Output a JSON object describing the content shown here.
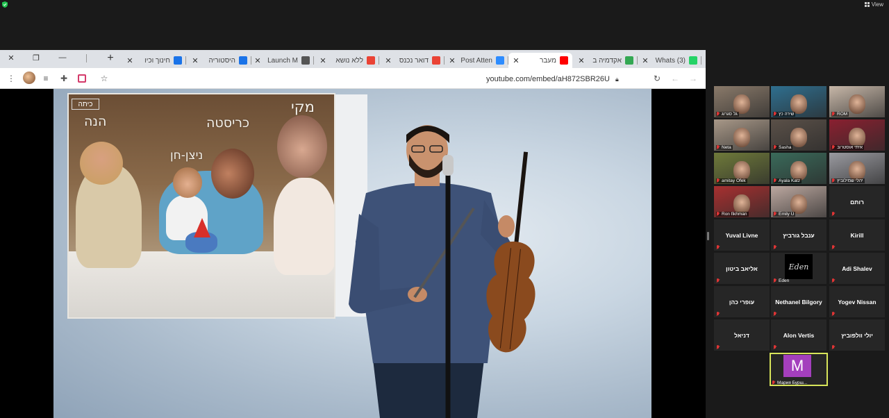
{
  "zoom_bar": {
    "view_label": "View"
  },
  "browser": {
    "new_tab_symbol": "+",
    "tabs": [
      {
        "title": "חינוך וכיו",
        "favicon_color": "#1a73e8",
        "active": false
      },
      {
        "title": "היסטוריה",
        "favicon_color": "#1a73e8",
        "active": false
      },
      {
        "title": "Launch M",
        "favicon_color": "#555555",
        "active": false
      },
      {
        "title": "ללא נושא",
        "favicon_color": "#ea4335",
        "active": false
      },
      {
        "title": "דואר נכנס",
        "favicon_color": "#ea4335",
        "active": false
      },
      {
        "title": "Post Atten",
        "favicon_color": "#2d8cff",
        "active": false
      },
      {
        "title": "מעבר",
        "favicon_color": "#ff0000",
        "active": true
      },
      {
        "title": "אקדמיה ב",
        "favicon_color": "#34a853",
        "active": false
      },
      {
        "title": "(3) Whats",
        "favicon_color": "#25d366",
        "active": false
      }
    ],
    "address": "youtube.com/embed/aH872SBR26U"
  },
  "video": {
    "logo_text": "כיתה",
    "photo_names": {
      "left": "הנה",
      "center": "כריסטה",
      "right": "מקי",
      "child": "ניצן-חן"
    }
  },
  "participants": [
    {
      "label": "גל סגרוג",
      "video": true,
      "bg": "#8a7a6a"
    },
    {
      "label": "שירה כץ",
      "video": true,
      "bg": "#2f6f8f"
    },
    {
      "label": "ROM",
      "video": true,
      "bg": "#c7b7a8"
    },
    {
      "label": "Neta",
      "video": true,
      "bg": "#a89888"
    },
    {
      "label": "Sasha",
      "video": true,
      "bg": "#5a5048"
    },
    {
      "label": "איתי אוסטרוב",
      "video": true,
      "bg": "#8a2030"
    },
    {
      "label": "amitay Ofek",
      "video": true,
      "bg": "#6f7a3a"
    },
    {
      "label": "Ayala Katz",
      "video": true,
      "bg": "#3a6a5a"
    },
    {
      "label": "יהלי שמילוביץ",
      "video": true,
      "bg": "#9a9aa0"
    },
    {
      "label": "Ron fikhman",
      "video": true,
      "bg": "#a83030"
    },
    {
      "label": "Emily U",
      "video": true,
      "bg": "#bca8a0"
    },
    {
      "label": "רותם",
      "video": false
    },
    {
      "label": "Yuval Livne",
      "video": false
    },
    {
      "label": "ענבל גורביץ",
      "video": false
    },
    {
      "label": "Kirill",
      "video": false
    },
    {
      "label": "אליאב ביטון",
      "video": false
    },
    {
      "label": "Eden",
      "video": false,
      "avatar_text": "Eden"
    },
    {
      "label": "Adi Shalev",
      "video": false
    },
    {
      "label": "עופרי כהן",
      "video": false
    },
    {
      "label": "Nethanel Bilgory",
      "video": false
    },
    {
      "label": "Yogev Nissan",
      "video": false
    },
    {
      "label": "דניאל",
      "video": false
    },
    {
      "label": "Alon Vertis",
      "video": false
    },
    {
      "label": "יולי וולפוביץ",
      "video": false
    },
    {
      "label": "Мария Бурш...",
      "video": false,
      "avatar_letter": "M",
      "highlight": true
    }
  ]
}
